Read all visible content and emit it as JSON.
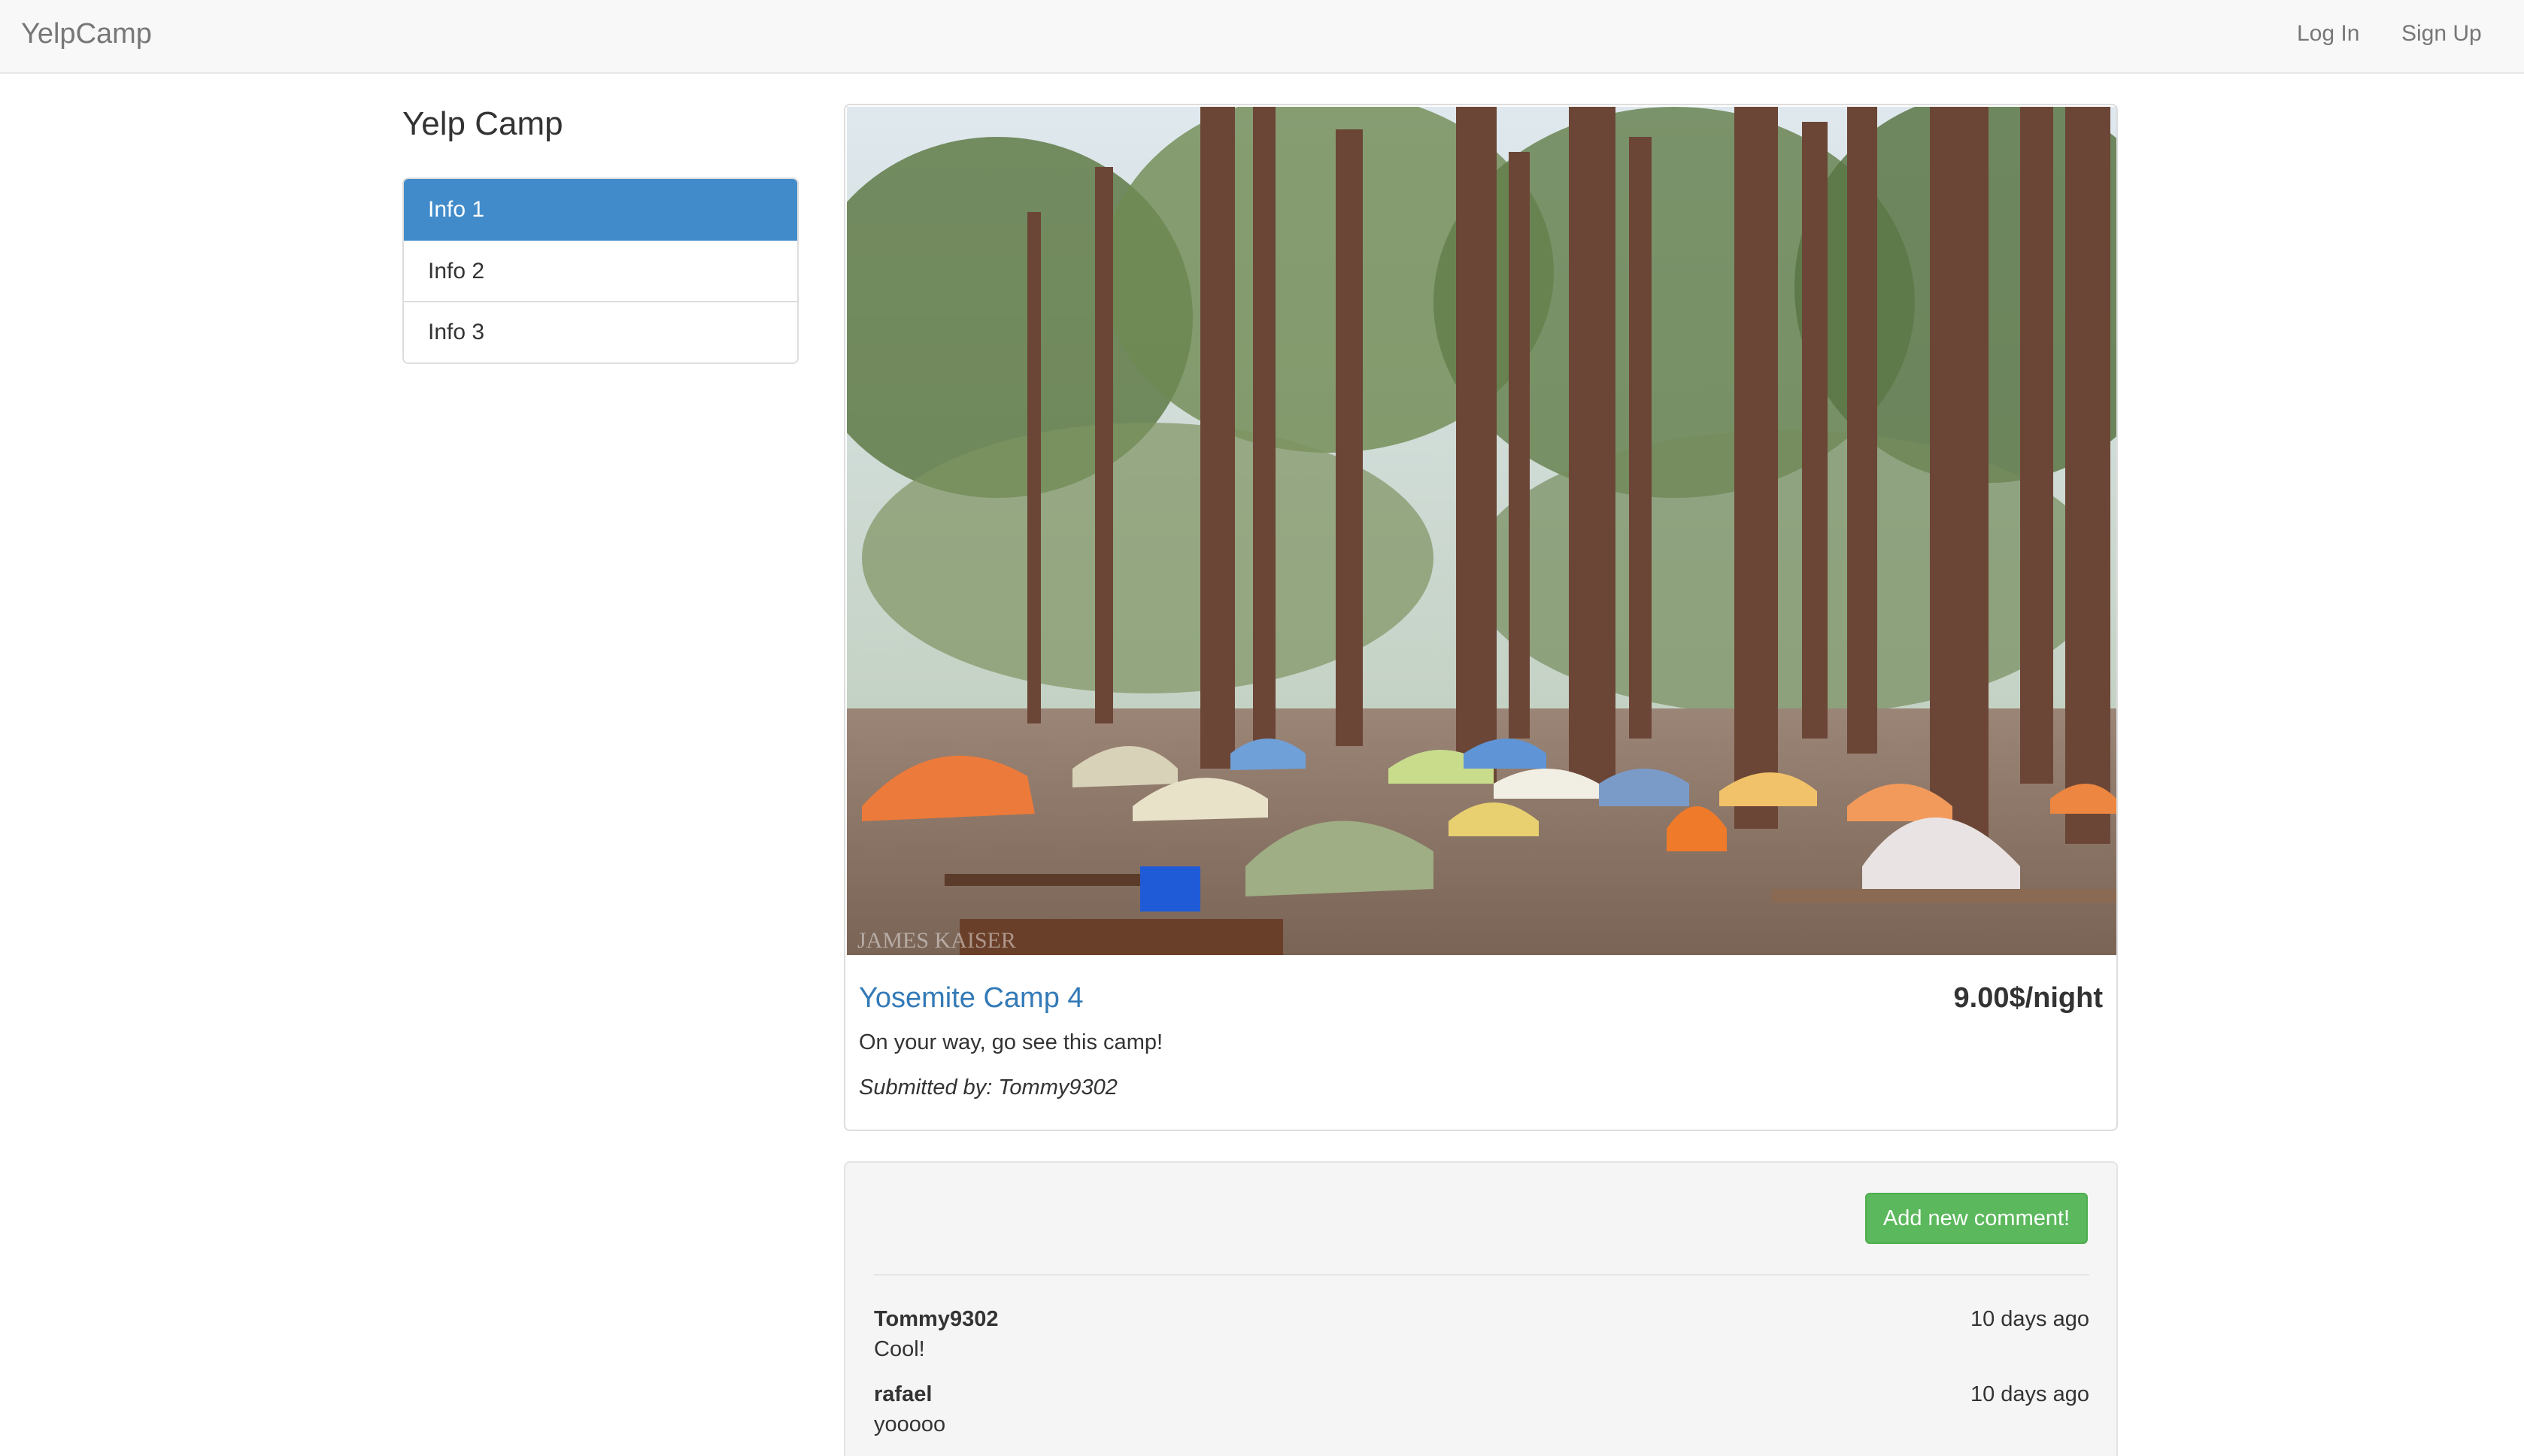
{
  "navbar": {
    "brand": "YelpCamp",
    "links": [
      {
        "label": "Log In"
      },
      {
        "label": "Sign Up"
      }
    ]
  },
  "sidebar": {
    "heading": "Yelp Camp",
    "items": [
      {
        "label": "Info 1",
        "active": true
      },
      {
        "label": "Info 2",
        "active": false
      },
      {
        "label": "Info 3",
        "active": false
      }
    ]
  },
  "campground": {
    "name": "Yosemite Camp 4",
    "price": "9.00$/night",
    "description": "On your way, go see this camp!",
    "submitted_by": "Submitted by: Tommy9302",
    "image_watermark": "JAMES KAISER"
  },
  "comments": {
    "add_button_label": "Add new comment!",
    "items": [
      {
        "author": "Tommy9302",
        "time": "10 days ago",
        "text": "Cool!"
      },
      {
        "author": "rafael",
        "time": "10 days ago",
        "text": "yooooo"
      }
    ]
  },
  "colors": {
    "active_item": "#428bca",
    "title_link": "#337ab7",
    "button_success": "#5cb85c"
  }
}
